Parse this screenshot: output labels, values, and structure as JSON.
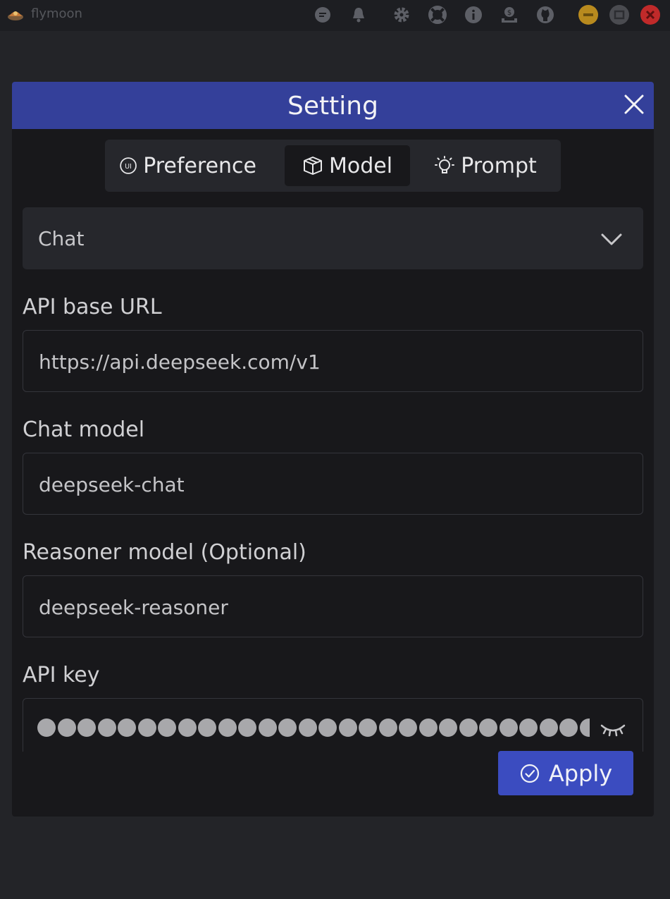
{
  "app": {
    "name": "flymoon"
  },
  "titlebar_icons": [
    "chat-bubble-icon",
    "bell-icon",
    "gear-icon",
    "lifebuoy-icon",
    "info-icon",
    "donate-icon",
    "github-icon"
  ],
  "window_controls": {
    "minimize_color": "#b88a1e",
    "maximize_color": "#4a4b50",
    "close_color": "#c02a2a"
  },
  "dialog": {
    "title": "Setting",
    "header_color": "#34409a",
    "tabs": [
      {
        "label": "Preference",
        "icon": "ui-badge-icon",
        "active": false
      },
      {
        "label": "Model",
        "icon": "cube-icon",
        "active": true
      },
      {
        "label": "Prompt",
        "icon": "lightbulb-icon",
        "active": false
      }
    ],
    "mode_select": {
      "value": "Chat"
    },
    "fields": {
      "api_base_url": {
        "label": "API base URL",
        "value": "https://api.deepseek.com/v1"
      },
      "chat_model": {
        "label": "Chat model",
        "value": "deepseek-chat"
      },
      "reasoner_model": {
        "label": "Reasoner model (Optional)",
        "value": "deepseek-reasoner"
      },
      "api_key": {
        "label": "API key",
        "masked": true
      }
    },
    "apply_button": {
      "label": "Apply",
      "color": "#3b4cc0"
    }
  }
}
